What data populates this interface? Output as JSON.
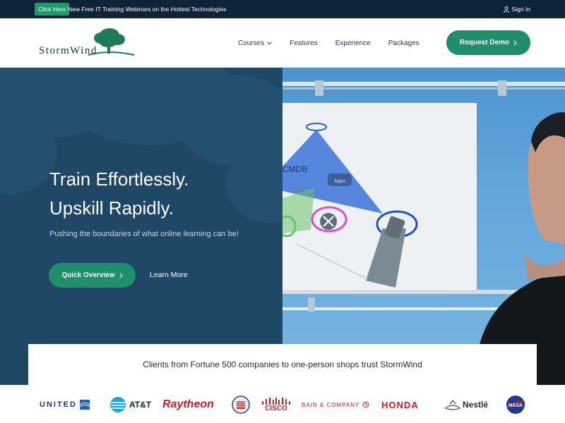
{
  "topbar": {
    "cta_label": "Click Here",
    "promo_text": "New Free IT Training Webinars on the Hottest Technologies",
    "signin_label": "Sign In"
  },
  "header": {
    "logo_text": "StormWind",
    "nav": [
      {
        "label": "Courses",
        "has_dropdown": true
      },
      {
        "label": "Features"
      },
      {
        "label": "Experience"
      },
      {
        "label": "Packages"
      }
    ],
    "demo_label": "Request Demo"
  },
  "hero": {
    "title_line1": "Train Effortlessly.",
    "title_line2": "Upskill Rapidly.",
    "subtitle": "Pushing the boundaries of what online learning can be!",
    "primary_cta": "Quick Overview",
    "secondary_cta": "Learn More",
    "screen_label_1": "CMDB",
    "screen_label_2": "CMDB",
    "screen_label_3": "Apps"
  },
  "clients": {
    "heading": "Clients from Fortune 500 companies to one-person shops trust StormWind",
    "logos": [
      "UNITED",
      "AT&T",
      "Raytheon",
      "CISCO",
      "BAIN & COMPANY",
      "HONDA",
      "Nestlé",
      "NASA"
    ]
  },
  "colors": {
    "accent": "#1f8e6a",
    "topbar": "#0f2438",
    "hero_left": "#1f4766"
  }
}
